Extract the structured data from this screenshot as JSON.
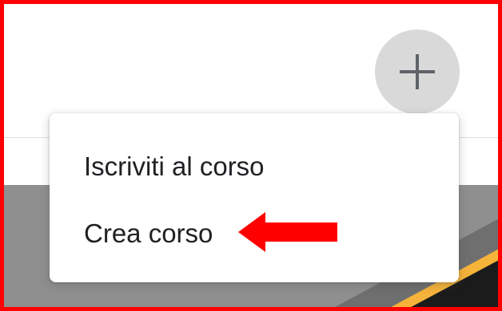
{
  "add_button": {
    "icon": "plus-icon"
  },
  "menu": {
    "items": [
      {
        "label": "Iscriviti al corso"
      },
      {
        "label": "Crea corso"
      }
    ]
  },
  "annotation": {
    "arrow_icon": "left-arrow-icon",
    "frame_color": "#ff0000",
    "arrow_color": "#ff0000"
  },
  "colors": {
    "fab_background": "#d9d9d9",
    "icon_color": "#5f6368",
    "card_gray": "#8f8f8f",
    "card_accent": "#f6b33a"
  }
}
